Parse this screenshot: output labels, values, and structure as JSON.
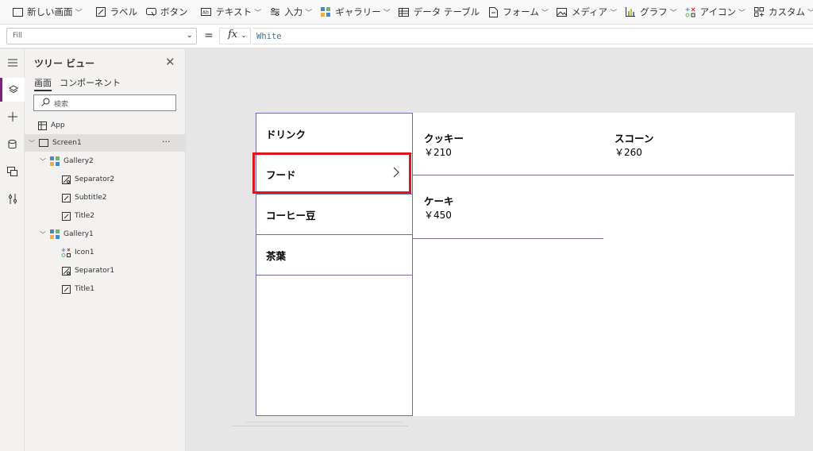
{
  "toolbar": {
    "items": [
      {
        "label": "新しい画面",
        "icon": "new-screen-icon",
        "dropdown": true
      },
      {
        "label": "ラベル",
        "icon": "label-icon",
        "dropdown": false
      },
      {
        "label": "ボタン",
        "icon": "button-icon",
        "dropdown": false
      },
      {
        "label": "テキスト",
        "icon": "text-icon",
        "dropdown": true
      },
      {
        "label": "入力",
        "icon": "input-icon",
        "dropdown": true
      },
      {
        "label": "ギャラリー",
        "icon": "gallery-icon",
        "dropdown": true
      },
      {
        "label": "データ テーブル",
        "icon": "data-table-icon",
        "dropdown": false
      },
      {
        "label": "フォーム",
        "icon": "form-icon",
        "dropdown": true
      },
      {
        "label": "メディア",
        "icon": "media-icon",
        "dropdown": true
      },
      {
        "label": "グラフ",
        "icon": "chart-icon",
        "dropdown": true
      },
      {
        "label": "アイコン",
        "icon": "icons-icon",
        "dropdown": true
      },
      {
        "label": "カスタム",
        "icon": "custom-icon",
        "dropdown": true
      }
    ]
  },
  "formula_bar": {
    "property": "Fill",
    "equals": "=",
    "fx": "fx",
    "formula": "White"
  },
  "tree": {
    "title": "ツリー ビュー",
    "tabs": [
      "画面",
      "コンポーネント"
    ],
    "active_tab": "画面",
    "search_placeholder": "検索",
    "nodes": [
      {
        "label": "App",
        "icon": "app-icon",
        "level": 0
      },
      {
        "label": "Screen1",
        "icon": "screen-icon",
        "level": 0,
        "selected": true
      },
      {
        "label": "Gallery2",
        "icon": "gallery-icon",
        "level": 1
      },
      {
        "label": "Separator2",
        "icon": "separator-icon",
        "level": 2
      },
      {
        "label": "Subtitle2",
        "icon": "label-icon",
        "level": 2
      },
      {
        "label": "Title2",
        "icon": "label-icon",
        "level": 2
      },
      {
        "label": "Gallery1",
        "icon": "gallery-icon",
        "level": 1
      },
      {
        "label": "Icon1",
        "icon": "icon-control-icon",
        "level": 2
      },
      {
        "label": "Separator1",
        "icon": "separator-icon",
        "level": 2
      },
      {
        "label": "Title1",
        "icon": "label-icon",
        "level": 2
      }
    ],
    "more": "···"
  },
  "gallery1": {
    "items": [
      "ドリンク",
      "フード",
      "コーヒー豆",
      "茶葉"
    ],
    "selected": "フード"
  },
  "gallery2": {
    "items": [
      {
        "title": "クッキー",
        "price": "￥210"
      },
      {
        "title": "スコーン",
        "price": "￥260"
      },
      {
        "title": "ケーキ",
        "price": "￥450"
      }
    ]
  },
  "colors": {
    "accent": "#742774",
    "highlight": "#e0141e",
    "gallery_border": "#6b6fa6"
  }
}
